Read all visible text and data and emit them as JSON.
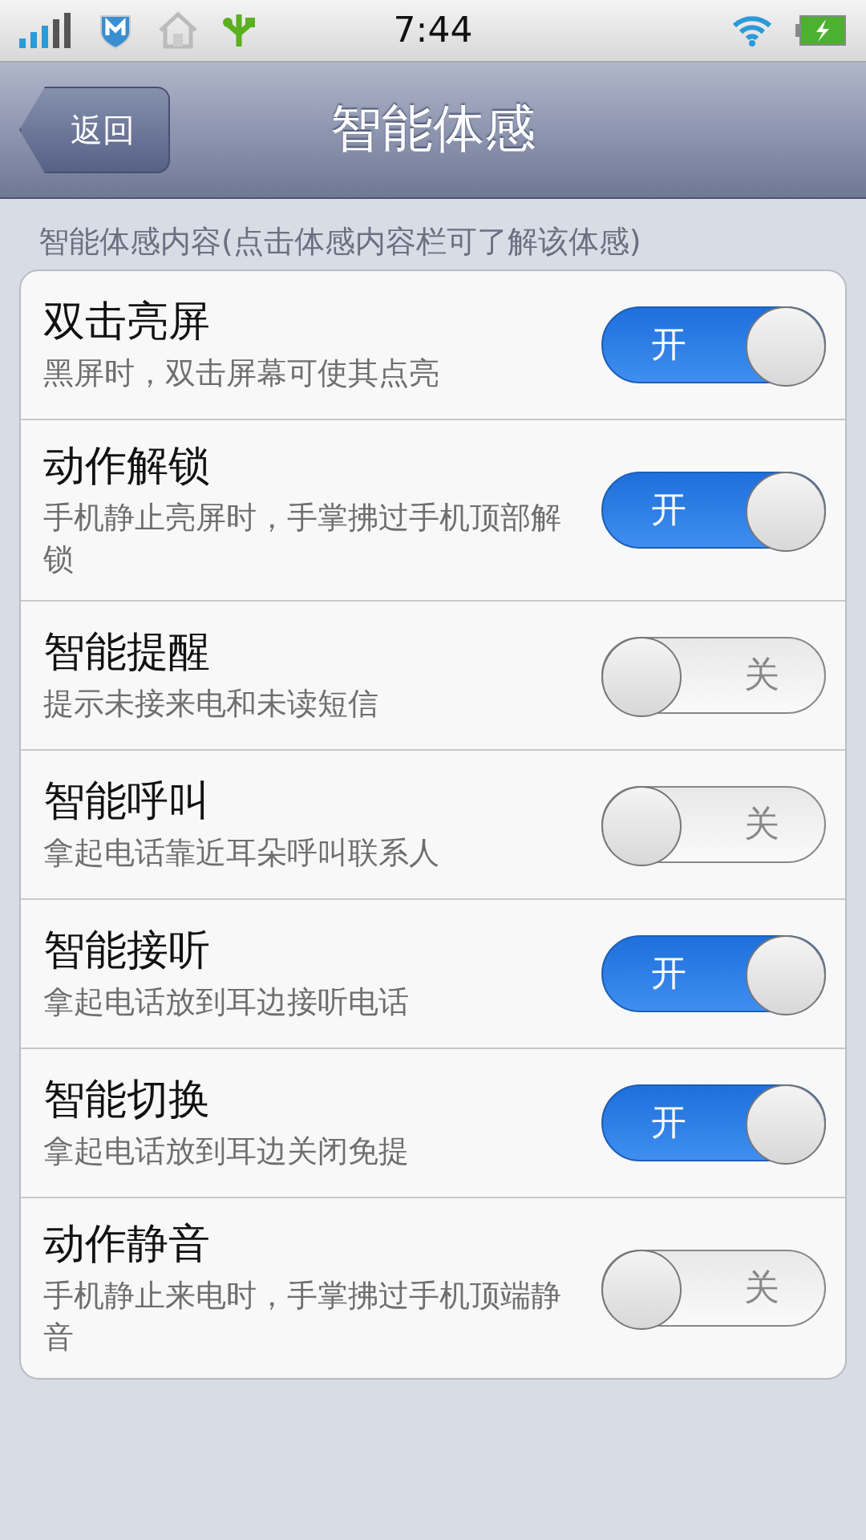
{
  "status_bar": {
    "time": "7:44"
  },
  "nav": {
    "back": "返回",
    "title": "智能体感"
  },
  "section_header": "智能体感内容(点击体感内容栏可了解该体感)",
  "items": [
    {
      "title": "双击亮屏",
      "description": "黑屏时，双击屏幕可使其点亮",
      "on": true,
      "toggle_label": "开"
    },
    {
      "title": "动作解锁",
      "description": "手机静止亮屏时，手掌拂过手机顶部解锁",
      "on": true,
      "toggle_label": "开"
    },
    {
      "title": "智能提醒",
      "description": "提示未接来电和未读短信",
      "on": false,
      "toggle_label": "关"
    },
    {
      "title": "智能呼叫",
      "description": "拿起电话靠近耳朵呼叫联系人",
      "on": false,
      "toggle_label": "关"
    },
    {
      "title": "智能接听",
      "description": "拿起电话放到耳边接听电话",
      "on": true,
      "toggle_label": "开"
    },
    {
      "title": "智能切换",
      "description": "拿起电话放到耳边关闭免提",
      "on": true,
      "toggle_label": "开"
    },
    {
      "title": "动作静音",
      "description": "手机静止来电时，手掌拂过手机顶端静音",
      "on": false,
      "toggle_label": "关"
    }
  ]
}
